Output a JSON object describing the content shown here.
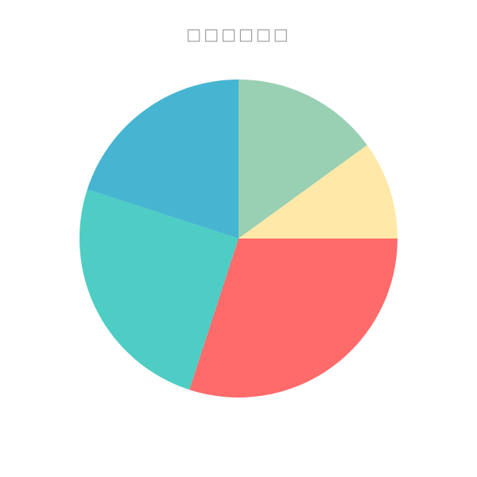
{
  "chart_data": {
    "type": "pie",
    "title": "□□□□□□",
    "start_angle": "12 o'clock",
    "direction": "clockwise",
    "slices": [
      {
        "value": 15,
        "color": "#99cfb2"
      },
      {
        "value": 10,
        "color": "#ffe8a8"
      },
      {
        "value": 30,
        "color": "#ff6b6b"
      },
      {
        "value": 25,
        "color": "#4ecdc4"
      },
      {
        "value": 20,
        "color": "#45b5d1"
      }
    ]
  }
}
